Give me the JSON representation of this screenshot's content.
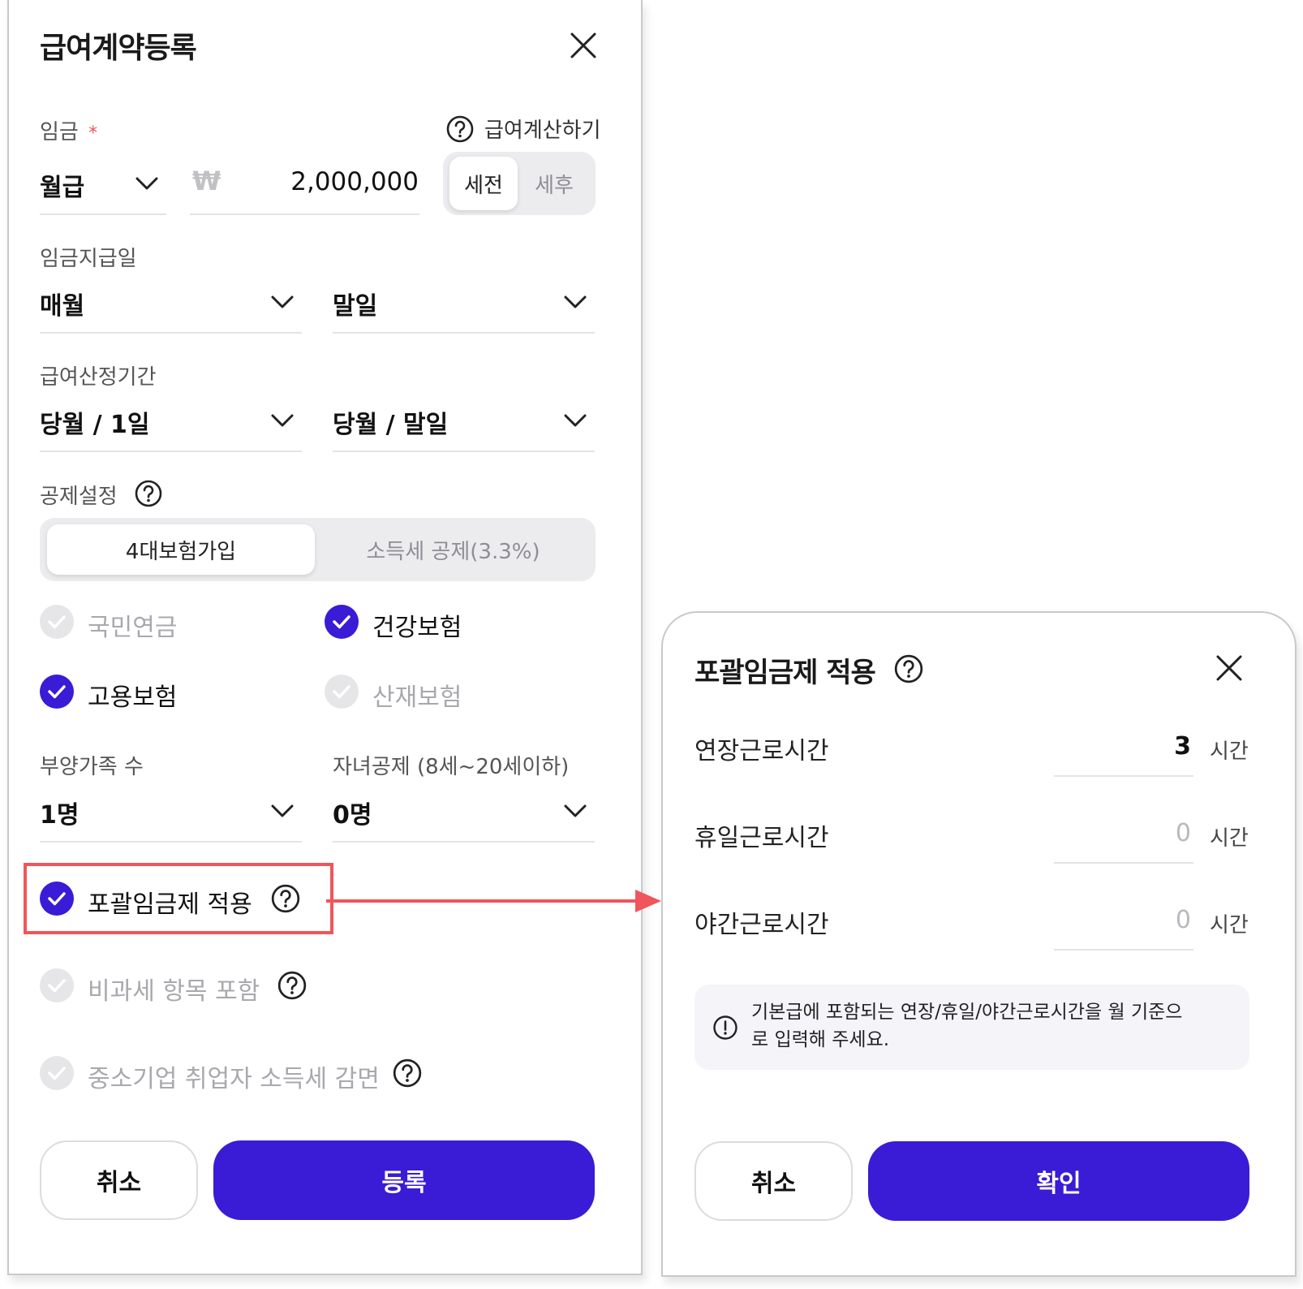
{
  "salary_form": {
    "title": "급여계약등록",
    "wage_label": "임금",
    "required_mark": "*",
    "calc_link": "급여계산하기",
    "pay_type": "월급",
    "currency_symbol": "₩",
    "amount": "2,000,000",
    "tax_toggle": {
      "selected": "세전",
      "other": "세후"
    },
    "payday_label": "임금지급일",
    "payday_cycle": "매월",
    "payday_day": "말일",
    "period_label": "급여산정기간",
    "period_start": "당월 / 1일",
    "period_end": "당월 / 말일",
    "deduction_label": "공제설정",
    "deduction_tabs": {
      "selected": "4대보험가입",
      "other": "소득세 공제(3.3%)"
    },
    "insurance": {
      "national_pension": {
        "label": "국민연금",
        "checked": false
      },
      "health": {
        "label": "건강보험",
        "checked": true
      },
      "employment": {
        "label": "고용보험",
        "checked": true
      },
      "industrial_accident": {
        "label": "산재보험",
        "checked": false
      }
    },
    "dependents_label": "부양가족 수",
    "dependents_value": "1명",
    "children_label": "자녀공제 (8세~20세이하)",
    "children_value": "0명",
    "inclusive_wage": {
      "label": "포괄임금제 적용",
      "checked": true
    },
    "nontaxable": {
      "label": "비과세 항목 포함",
      "checked": false
    },
    "sme_reduction": {
      "label": "중소기업 취업자 소득세 감면",
      "checked": false
    },
    "cancel_label": "취소",
    "submit_label": "등록"
  },
  "inclusive_dialog": {
    "title": "포괄임금제 적용",
    "rows": [
      {
        "label": "연장근로시간",
        "value": "3",
        "unit": "시간"
      },
      {
        "label": "휴일근로시간",
        "value": "0",
        "unit": "시간"
      },
      {
        "label": "야간근로시간",
        "value": "0",
        "unit": "시간"
      }
    ],
    "notice_line1": "기본급에 포함되는 연장/휴일/야간근로시간을 월 기준으",
    "notice_line2": "로 입력해 주세요.",
    "cancel_label": "취소",
    "confirm_label": "확인"
  },
  "colors": {
    "primary": "#3a1bd6",
    "highlight": "#f0555b",
    "disabled": "#a8a8ae"
  }
}
